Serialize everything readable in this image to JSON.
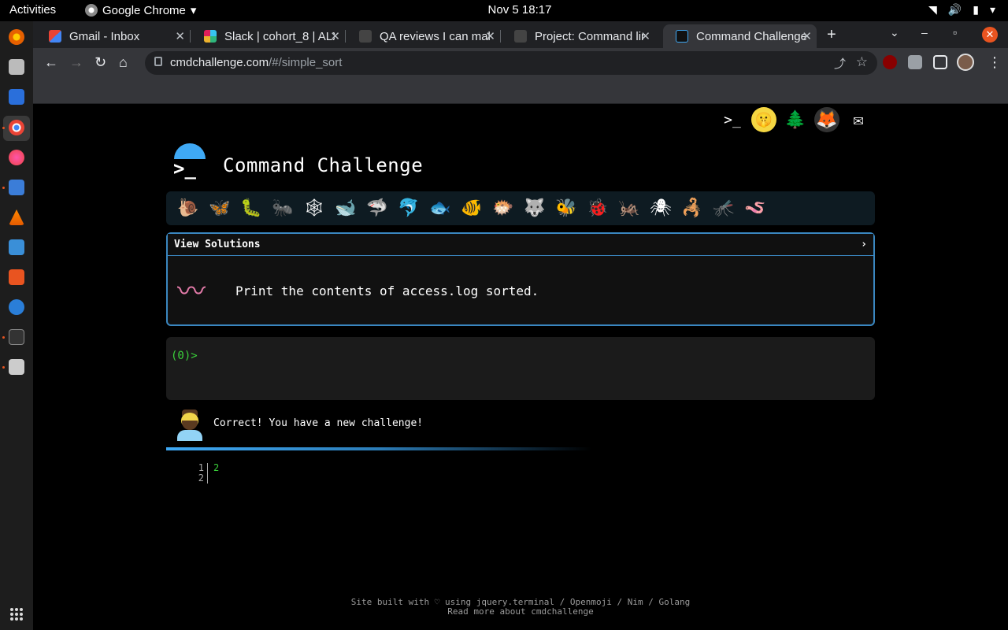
{
  "system": {
    "activities": "Activities",
    "app_name": "Google Chrome",
    "clock": "Nov 5  18:17"
  },
  "tabs": [
    {
      "title": "Gmail - Inbox",
      "active": false
    },
    {
      "title": "Slack | cohort_8 | ALX",
      "active": false
    },
    {
      "title": "QA reviews I can make",
      "active": false
    },
    {
      "title": "Project: Command line",
      "active": false
    },
    {
      "title": "Command Challenge",
      "active": true
    }
  ],
  "omnibox": {
    "host": "cmdchallenge.com",
    "path": "/#/simple_sort"
  },
  "site": {
    "title": "Command Challenge",
    "prompt_glyph": ">_"
  },
  "challenge": {
    "view_solutions": "View Solutions",
    "chevron": "›",
    "description": "Print the contents of access.log sorted."
  },
  "terminal": {
    "prompt": "(0)>"
  },
  "feedback": {
    "message": "Correct! You have a new challenge!"
  },
  "output": {
    "line_numbers": [
      "1",
      "2"
    ],
    "lines": [
      "2",
      ""
    ]
  },
  "footer": {
    "line1": "Site built with ♡ using jquery.terminal / Openmoji / Nim / Golang",
    "line2": "Read more about cmdchallenge"
  },
  "bug_strip": [
    "🐌",
    "🦋",
    "🐛",
    "🐜",
    "🕸",
    "🐋",
    "🦈",
    "🐬",
    "🐟",
    "🐠",
    "🐡",
    "🐺",
    "🐝",
    "🐞",
    "🦗",
    "🕷",
    "🦂",
    "🦟",
    "🪱"
  ],
  "colors": {
    "accent": "#3a87c0",
    "prompt_green": "#3ad13a",
    "ubuntu_orange": "#e95420"
  }
}
